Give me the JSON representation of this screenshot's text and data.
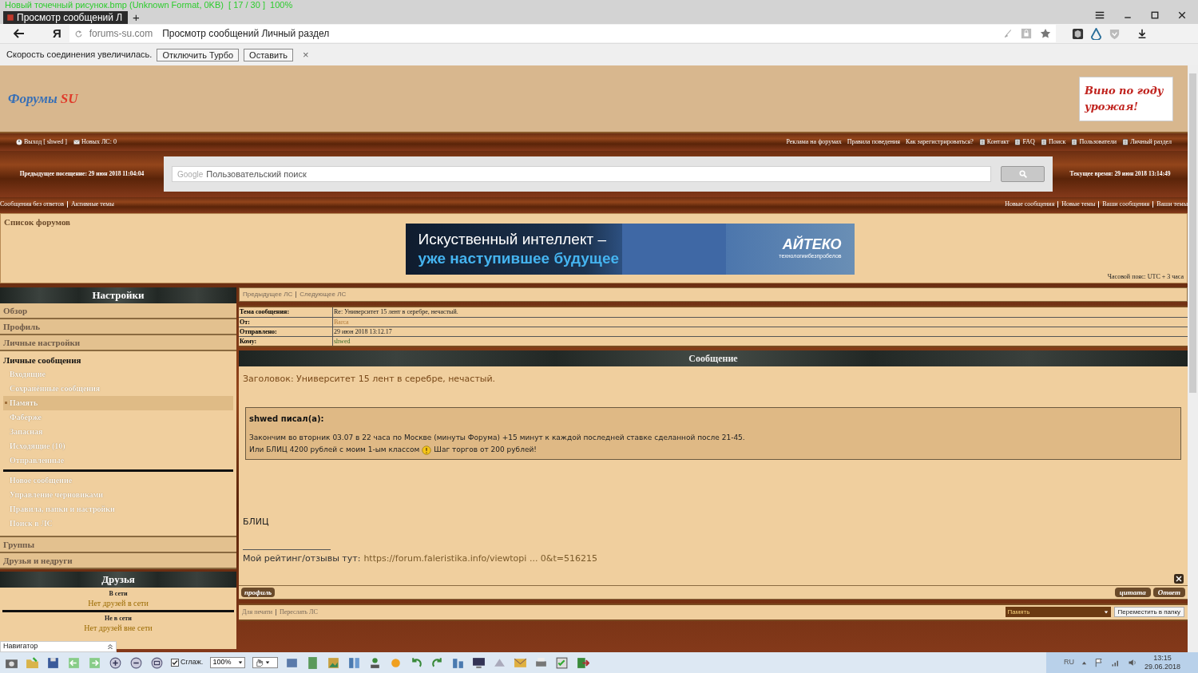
{
  "viewer": {
    "info": "Новый точечный рисунок.bmp (Unknown Format, 0KB)  [ 17 / 30 ]  100%",
    "navigator": "Навигатор",
    "smoothing": {
      "label": "Сглаж.",
      "checked": true
    },
    "zoom": "100%"
  },
  "browser": {
    "tab": "Просмотр сообщений Л",
    "new_tab": "+",
    "logo": "Я",
    "domain": "forums-su.com",
    "page_title": "Просмотр сообщений Личный раздел"
  },
  "turbo_bar": {
    "message": "Скорость соединения увеличилась.",
    "buttons": [
      "Отключить Турбо",
      "Оставить"
    ],
    "close": "×"
  },
  "forum": {
    "logo_main": "Форумы",
    "logo_accent": "SU",
    "ad": "Вино по году урожая!",
    "user_links": [
      {
        "kind": "logout",
        "label": "Выход [ shwed ]"
      },
      {
        "kind": "pm",
        "label": "Новых ЛС: 0"
      }
    ],
    "top_links": [
      {
        "kind": "text",
        "label": "Реклама на форумах"
      },
      {
        "kind": "text",
        "label": "Правила поведения"
      },
      {
        "kind": "text",
        "label": "Как зарегистрироваться?"
      },
      {
        "kind": "icon",
        "label": "Контакт"
      },
      {
        "kind": "icon",
        "label": "FAQ"
      },
      {
        "kind": "icon",
        "label": "Поиск"
      },
      {
        "kind": "icon",
        "label": "Пользователи"
      },
      {
        "kind": "icon",
        "label": "Личный раздел"
      }
    ],
    "previous_visit": "Предыдущее посещение: 29 июн 2018 11:04:04",
    "search": {
      "brand": "Google",
      "placeholder": "Пользовательский поиск"
    },
    "current_time": "Текущее время: 29 июн 2018 13:14:49",
    "quick_links_left": [
      "Сообщения без ответов",
      "Активные темы"
    ],
    "quick_links_right": [
      "Новые сообщения",
      "Новые темы",
      "Ваши сообщения",
      "Ваши темы"
    ],
    "breadcrumb": "Список форумов",
    "banner": {
      "line_1": "Искуственный интеллект –",
      "line_2": "уже наступившее будущее",
      "brand": "АЙТЕКО",
      "slogan": "технологиибезпробелов"
    },
    "timezone": "Часовой пояс: UTC + 3 часа"
  },
  "settings_panel": {
    "title": "Настройки",
    "tabs": [
      {
        "label": "Обзор",
        "selected": false
      },
      {
        "label": "Профиль",
        "selected": false
      },
      {
        "label": "Личные настройки",
        "selected": false
      },
      {
        "label": "Личные сообщения",
        "selected": true,
        "folders": [
          {
            "label": "Входящие",
            "selected": false
          },
          {
            "label": "Сохранённые сообщения",
            "selected": false
          },
          {
            "label": "Память",
            "selected": true
          },
          {
            "label": "Фаберже",
            "selected": false
          },
          {
            "label": "Запасная",
            "selected": false
          },
          {
            "label": "Исходящие (10)",
            "selected": false
          },
          {
            "label": "Отправленные",
            "selected": false
          }
        ],
        "actions": [
          "Новое сообщение",
          "Управление черновиками",
          "Правила, папки и настройки",
          "Поиск в ЛС"
        ]
      },
      {
        "label": "Группы",
        "selected": false
      },
      {
        "label": "Друзья и недруги",
        "selected": false
      }
    ]
  },
  "friends_panel": {
    "title": "Друзья",
    "online_heading": "В сети",
    "online_empty": "Нет друзей в сети",
    "offline_heading": "Не в сети",
    "offline_empty": "Нет друзей вне сети"
  },
  "message": {
    "nav": [
      "Предыдущее ЛС",
      "Следующее ЛС"
    ],
    "headers": [
      {
        "kind": "text",
        "label": "Тема сообщения:",
        "value": "Re: Университет 15 лент в серебре, нечастый."
      },
      {
        "kind": "user",
        "label": "От:",
        "value": "Barca"
      },
      {
        "kind": "text",
        "label": "Отправлено:",
        "value": "29 июн 2018 13:12.17"
      },
      {
        "kind": "user",
        "label": "Кому:",
        "value": "shwed"
      }
    ],
    "section_title": "Сообщение",
    "subject": "Заголовок: Университет 15 лент в серебре, нечастый.",
    "quote": {
      "author": "shwed писал(а):",
      "lines": [
        [
          "Закончим во вторник 03.07 в 22 часа по Москве (минуты Форума) +15 минут к каждой последней ставке сделанной после 21-45."
        ],
        [
          "Или БЛИЦ 4200 рублей с моим 1-ым классом",
          "Шаг торгов от 200 рублей!"
        ]
      ]
    },
    "body": "БЛИЦ",
    "signature": {
      "label": "Мой рейтинг/отзывы тут:",
      "link": "https://forum.faleristika.info/viewtopi ... 0&t=516215"
    },
    "buttons": {
      "profile": "профиль",
      "quote": "цитата",
      "reply": "Ответ"
    },
    "footer_links": [
      "Для печати",
      "Переслать ЛС"
    ],
    "folder_select": "Память",
    "move_button": "Переместить в папку"
  },
  "tray": {
    "language": "RU",
    "time": "13:15",
    "date": "29.06.2018"
  }
}
